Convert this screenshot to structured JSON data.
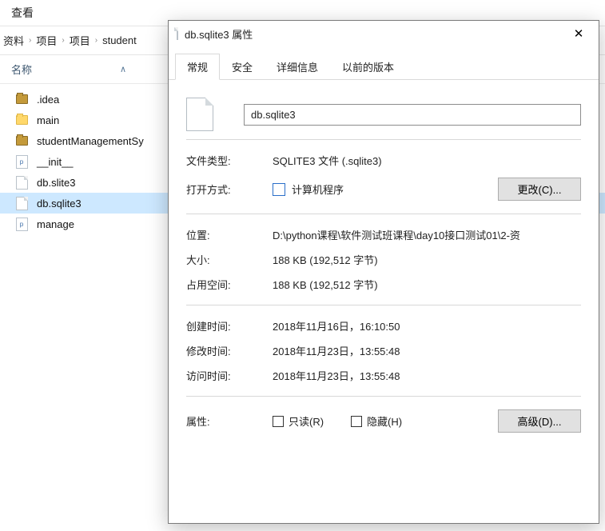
{
  "explorer": {
    "menu_view": "查看",
    "breadcrumb": [
      "资料",
      "项目",
      "项目",
      "student"
    ],
    "column_name": "名称",
    "sort_indicator": "∧",
    "files": [
      {
        "name": ".idea",
        "type": "folder-dark"
      },
      {
        "name": "main",
        "type": "folder"
      },
      {
        "name": "studentManagementSy",
        "type": "folder-dark"
      },
      {
        "name": "__init__",
        "type": "py"
      },
      {
        "name": "db.slite3",
        "type": "doc"
      },
      {
        "name": "db.sqlite3",
        "type": "doc",
        "selected": true
      },
      {
        "name": "manage",
        "type": "py"
      }
    ]
  },
  "dialog": {
    "title": "db.sqlite3 属性",
    "tabs": {
      "general": "常规",
      "security": "安全",
      "details": "详细信息",
      "previous": "以前的版本"
    },
    "filename": "db.sqlite3",
    "labels": {
      "filetype": "文件类型:",
      "openwith": "打开方式:",
      "location": "位置:",
      "size": "大小:",
      "sizeondisk": "占用空间:",
      "created": "创建时间:",
      "modified": "修改时间:",
      "accessed": "访问时间:",
      "attributes": "属性:"
    },
    "values": {
      "filetype": "SQLITE3 文件 (.sqlite3)",
      "openwith_app": "计算机程序",
      "location": "D:\\python课程\\软件测试班课程\\day10接口测试01\\2-资",
      "size": "188 KB (192,512 字节)",
      "sizeondisk": "188 KB (192,512 字节)",
      "created": "2018年11月16日，16:10:50",
      "modified": "2018年11月23日，13:55:48",
      "accessed": "2018年11月23日，13:55:48"
    },
    "buttons": {
      "change": "更改(C)...",
      "advanced": "高级(D)..."
    },
    "checkboxes": {
      "readonly": "只读(R)",
      "hidden": "隐藏(H)"
    }
  }
}
